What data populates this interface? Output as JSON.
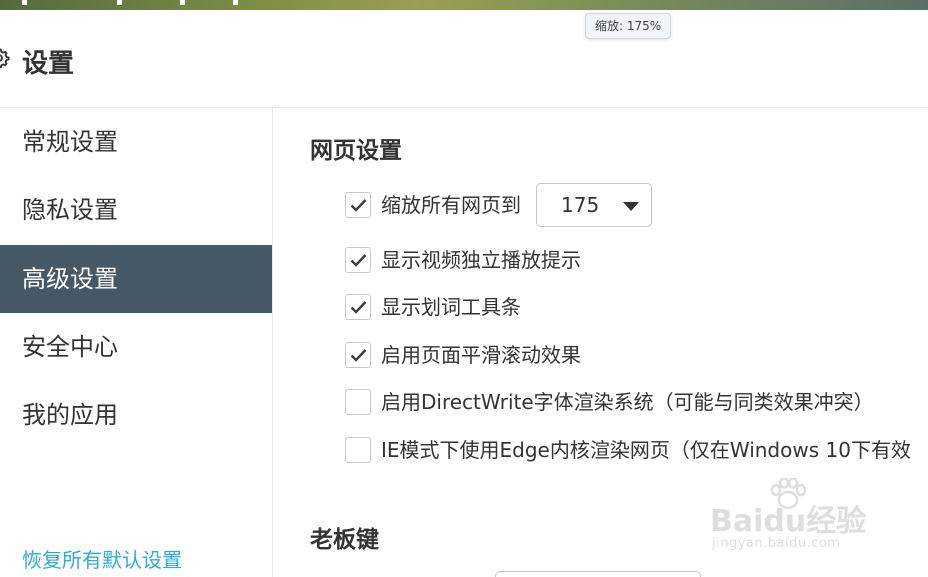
{
  "tooltip": {
    "zoom_text": "缩放: 175%"
  },
  "header": {
    "title": "设置",
    "icon": "gear-icon"
  },
  "sidebar": {
    "items": [
      {
        "label": "常规设置",
        "active": false
      },
      {
        "label": "隐私设置",
        "active": false
      },
      {
        "label": "高级设置",
        "active": true
      },
      {
        "label": "安全中心",
        "active": false
      },
      {
        "label": "我的应用",
        "active": false
      }
    ],
    "restore_label": "恢复所有默认设置"
  },
  "main": {
    "webpage_section": {
      "title": "网页设置",
      "options": [
        {
          "label": "缩放所有网页到",
          "checked": true
        },
        {
          "label": "显示视频独立播放提示",
          "checked": true
        },
        {
          "label": "显示划词工具条",
          "checked": true
        },
        {
          "label": "启用页面平滑滚动效果",
          "checked": true
        },
        {
          "label": "启用DirectWrite字体渲染系统（可能与同类效果冲突）",
          "checked": false
        },
        {
          "label": "IE模式下使用Edge内核渲染网页（仅在Windows 10下有效",
          "checked": false
        }
      ],
      "zoom_select": {
        "value": "175"
      }
    },
    "boss_key_section": {
      "title": "老板键"
    }
  },
  "watermark": {
    "brand": "Baidu经验",
    "url": "jingyan.baidu.com"
  },
  "colors": {
    "sidebar_active_bg": "#465866",
    "link": "#2eaadc",
    "checkmark": "#3a3f44"
  }
}
